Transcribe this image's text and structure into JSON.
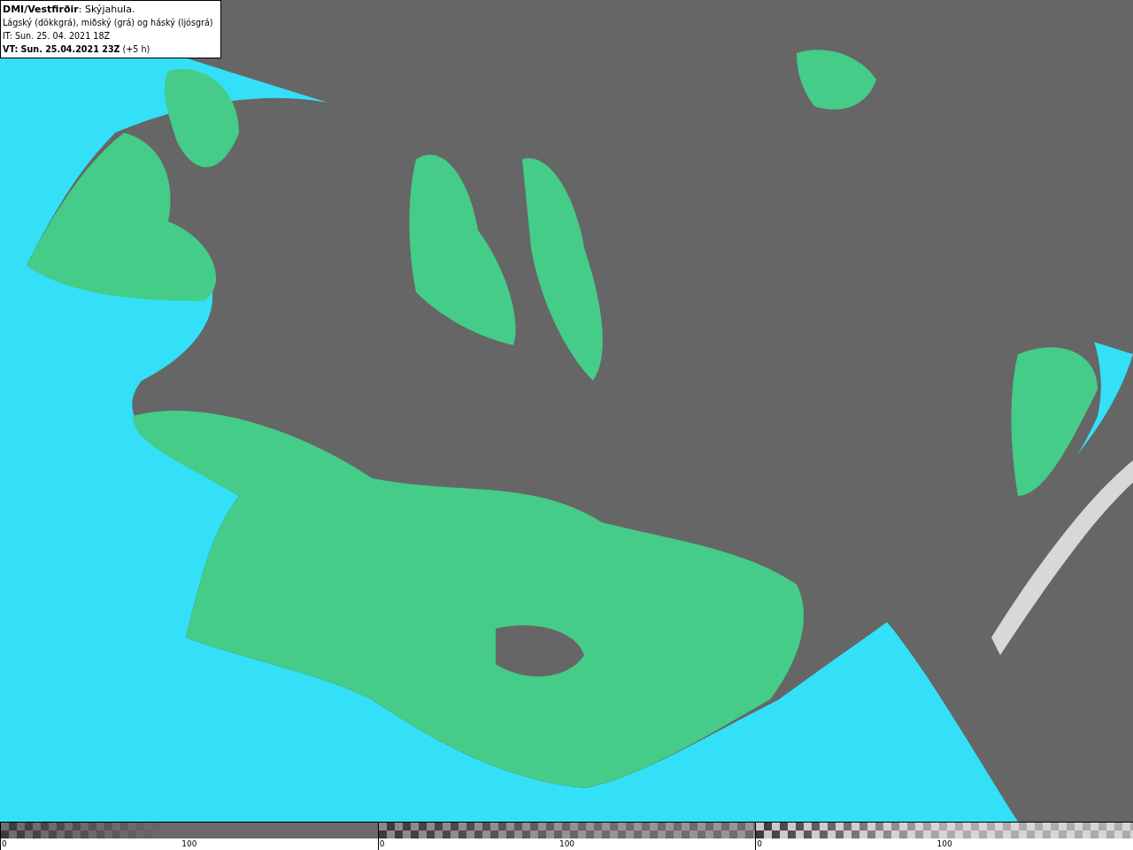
{
  "header": {
    "lines": [
      "**DMI/Vestfirðir**: Skýjahula.",
      "Lágský (dökkgrá), miðský (grá) og háský (ljósgrá)",
      "IT: Sun. 25. 04. 2021 18Z",
      "**VT: Sun. 25.04.2021 23Z** (+5 h)"
    ]
  },
  "legend": [
    {
      "ticks": [
        "0",
        "100"
      ]
    },
    {
      "ticks": [
        "0",
        "100"
      ]
    },
    {
      "ticks": [
        "0",
        "100"
      ]
    }
  ]
}
